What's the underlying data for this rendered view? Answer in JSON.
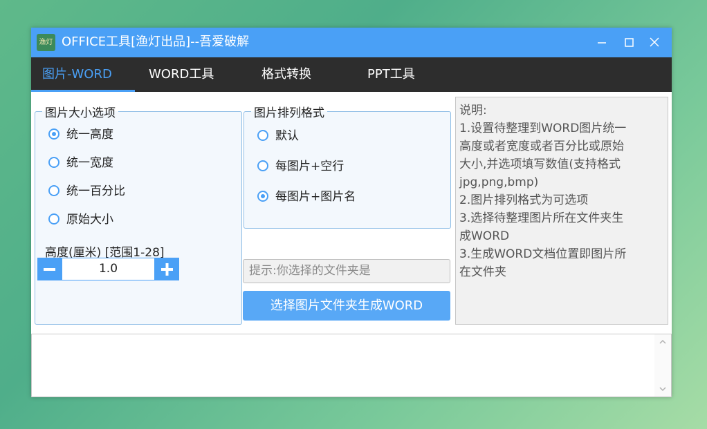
{
  "window": {
    "title": "OFFICE工具[渔灯出品]--吾爱破解",
    "icon_text": "渔灯",
    "accent_color": "#4aa0f6",
    "menubar_color": "#2d2d2d"
  },
  "tabs": [
    {
      "label": "图片-WORD",
      "active": true
    },
    {
      "label": "WORD工具",
      "active": false
    },
    {
      "label": "格式转换",
      "active": false
    },
    {
      "label": "PPT工具",
      "active": false
    }
  ],
  "size_options": {
    "legend": "图片大小选项",
    "options": [
      {
        "label": "统一高度",
        "checked": true
      },
      {
        "label": "统一宽度",
        "checked": false
      },
      {
        "label": "统一百分比",
        "checked": false
      },
      {
        "label": "原始大小",
        "checked": false
      }
    ],
    "value_label": "高度(厘米) [范围1-28]",
    "value": "1.0"
  },
  "layout_options": {
    "legend": "图片排列格式",
    "options": [
      {
        "label": "默认",
        "checked": false
      },
      {
        "label": "每图片+空行",
        "checked": false
      },
      {
        "label": "每图片+图片名",
        "checked": true
      }
    ]
  },
  "folder_hint": "提示:你选择的文件夹是",
  "generate_button": "选择图片文件夹生成WORD",
  "description": {
    "lines": [
      "说明:",
      "1.设置待整理到WORD图片统一",
      "高度或者宽度或者百分比或原始",
      "大小,并选项填写数值(支持格式",
      "jpg,png,bmp)",
      "2.图片排列格式为可选项",
      "3.选择待整理图片所在文件夹生",
      "成WORD",
      "3.生成WORD文档位置即图片所",
      "在文件夹"
    ]
  },
  "log_text": ""
}
